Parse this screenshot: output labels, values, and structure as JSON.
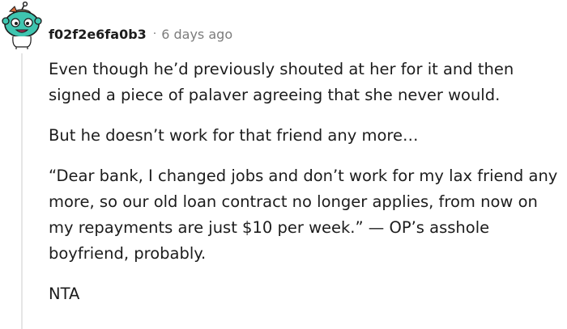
{
  "comment": {
    "author": "f02f2e6fa0b3",
    "separator": "·",
    "timestamp": "6 days ago",
    "avatar_icon": "snoo-avatar-icon",
    "paragraphs": [
      "Even though he’d previously shouted at her for it and then signed a piece of palaver agreeing that she never would.",
      "But he doesn’t work for that friend any more…",
      "“Dear bank, I changed jobs and don’t work for my lax friend any more, so our old loan contract no longer applies, from now on my repayments are just $10 per week.” — OP’s asshole boyfriend, probably.",
      "NTA"
    ]
  },
  "colors": {
    "text": "#1c1c1c",
    "meta": "#7c7c7c",
    "avatar_teal": "#3fc5b0",
    "thread_line": "#e5e5e5"
  }
}
